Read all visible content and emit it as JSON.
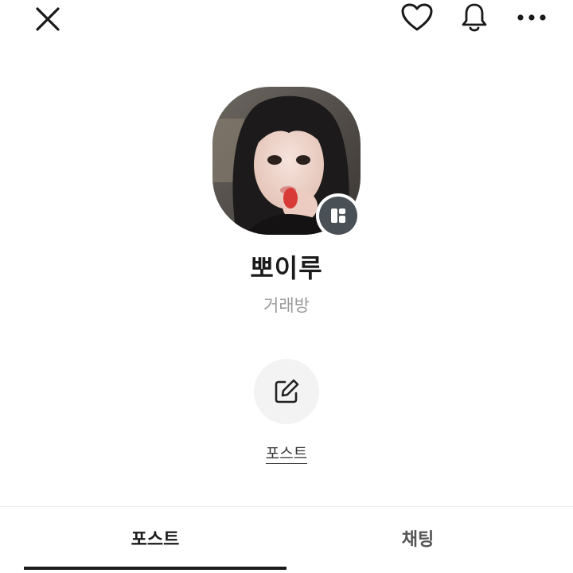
{
  "header": {
    "close_icon": "close-icon",
    "like_icon": "heart-icon",
    "notification_icon": "bell-icon",
    "more_icon": "more-dots-icon"
  },
  "profile": {
    "name": "뽀이루",
    "subtitle": "거래방",
    "badge_icon": "board-icon"
  },
  "actions": [
    {
      "label": "포스트",
      "icon": "edit-icon"
    }
  ],
  "tabs": [
    {
      "label": "포스트",
      "active": true
    },
    {
      "label": "채팅",
      "active": false
    }
  ],
  "colors": {
    "badge": "#4a5156",
    "action_bg": "#f3f3f3",
    "active_tab": "#1a1a1a",
    "subtitle": "#9a9a9a"
  }
}
